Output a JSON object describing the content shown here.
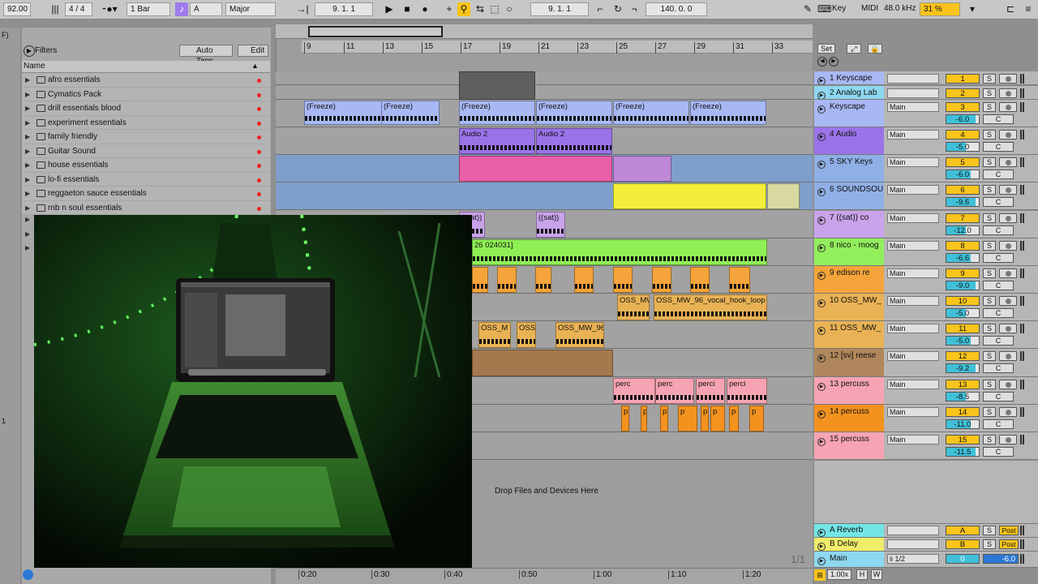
{
  "transport": {
    "tempo": "92.00",
    "time_sig": "4 / 4",
    "quantize": "1 Bar",
    "key": "A",
    "scale": "Major",
    "position": "9. 1. 1",
    "loop_start": "9. 1. 1",
    "loop_length": "140. 0. 0",
    "key_label": "Key",
    "midi_label": "MIDI",
    "sample_rate": "48.0 kHz",
    "cpu": "31 %"
  },
  "browser": {
    "filters_label": "Filters",
    "auto_tags_label": "Auto Tags",
    "edit_label": "Edit",
    "name_header": "Name",
    "left_frag": "F)",
    "left_num": "1",
    "folders": [
      "afro essentials",
      "Cymatics Pack",
      "drill essentials blood",
      "experiment essentials",
      "family friendly",
      "Guitar Sound",
      "house essentials",
      "lo-fi essentials",
      "reggaeton sauce essentials",
      "rnb n soul essentials"
    ]
  },
  "ruler": {
    "bars": [
      "9",
      "11",
      "13",
      "15",
      "17",
      "19",
      "21",
      "23",
      "25",
      "27",
      "29",
      "31",
      "33"
    ],
    "set_label": "Set"
  },
  "clips": {
    "freeze": "(Freeze)",
    "audio2": "Audio 2",
    "sat": "((sat))",
    "green": "26 024031]",
    "oss_m": "OSS_M",
    "oss": "OSS",
    "oss_mw96": "OSS_MW_96",
    "oss_mw": "OSS_MW",
    "oss_hook": "OSS_MW_96_vocal_hook_loop",
    "perc": "perc",
    "perci": "perci",
    "p": "p",
    "drop_text": "Drop Files and Devices Here"
  },
  "tracks": [
    {
      "name": "1 Keyscape",
      "num": "1",
      "vol": "",
      "color": "#a8b8f4"
    },
    {
      "name": "2 Analog Lab",
      "num": "2",
      "vol": "",
      "color": "#8ed7f0"
    },
    {
      "name": "Keyscape",
      "num": "3",
      "vol": "-6.0",
      "color": "#a8b8f4",
      "route": "Main"
    },
    {
      "name": "4 Audio",
      "num": "4",
      "vol": "-5.0",
      "color": "#9a73e8",
      "route": "Main"
    },
    {
      "name": "5 SKY Keys",
      "num": "5",
      "vol": "-6.0",
      "color": "#8fb0e6",
      "route": "Main"
    },
    {
      "name": "6 SOUNDSOU",
      "num": "6",
      "vol": "-9.6",
      "color": "#8fb0e6",
      "route": "Main"
    },
    {
      "name": "7 ((sat))   co",
      "num": "7",
      "vol": "-12.0",
      "color": "#c9a3ea",
      "route": "Main"
    },
    {
      "name": "8 nico - moog",
      "num": "8",
      "vol": "-6.6",
      "color": "#93ee5c",
      "route": "Main"
    },
    {
      "name": "9     edison re",
      "num": "9",
      "vol": "-9.0",
      "color": "#f4a43a",
      "route": "Main"
    },
    {
      "name": "10 OSS_MW_",
      "num": "10",
      "vol": "-5.0",
      "color": "#e9b255",
      "route": "Main"
    },
    {
      "name": "11 OSS_MW_",
      "num": "11",
      "vol": "-5.0",
      "color": "#e9b255",
      "route": "Main"
    },
    {
      "name": "12 [sv] reese",
      "num": "12",
      "vol": "-9.2",
      "color": "#b0875c",
      "route": "Main"
    },
    {
      "name": "13     percuss",
      "num": "13",
      "vol": "-8.5",
      "color": "#f6a4b3",
      "route": "Main"
    },
    {
      "name": "14     percuss",
      "num": "14",
      "vol": "-11.0",
      "color": "#f4921f",
      "route": "Main"
    },
    {
      "name": "15     percuss",
      "num": "15",
      "vol": "-11.5",
      "color": "#f6a4b3",
      "route": "Main"
    }
  ],
  "returns": [
    {
      "name": "A Reverb",
      "letter": "A",
      "post": "Post"
    },
    {
      "name": "B Delay",
      "letter": "B",
      "post": "Post"
    }
  ],
  "master": {
    "name": "Main",
    "route": "ii 1/2",
    "num": "0",
    "vol": "-6.0",
    "fraction": "1/1"
  },
  "time": {
    "marks": [
      "0:20",
      "0:30",
      "0:40",
      "0:50",
      "1:00",
      "1:10",
      "1:20"
    ],
    "zoom": "1.00x",
    "h": "H",
    "w": "W"
  },
  "colors": {
    "yellow": "#f9c41b",
    "cyan": "#3fc0d8"
  }
}
